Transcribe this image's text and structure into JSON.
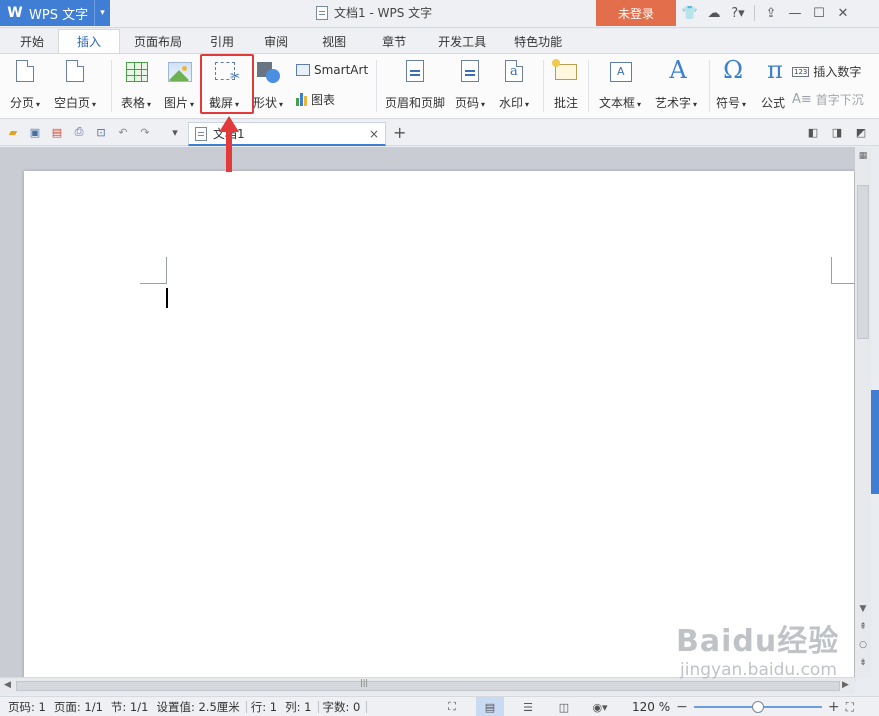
{
  "app": {
    "name": "WPS 文字",
    "window_title": "文档1 - WPS 文字",
    "login": "未登录"
  },
  "tabs": [
    "开始",
    "插入",
    "页面布局",
    "引用",
    "审阅",
    "视图",
    "章节",
    "开发工具",
    "特色功能"
  ],
  "active_tab": "插入",
  "ribbon": {
    "page_break": "分页",
    "blank_page": "空白页",
    "table": "表格",
    "picture": "图片",
    "screenshot": "截屏",
    "shape": "形状",
    "smartart": "SmartArt",
    "chart": "图表",
    "header_footer": "页眉和页脚",
    "page_number": "页码",
    "watermark": "水印",
    "comment": "批注",
    "text_box": "文本框",
    "word_art": "艺术字",
    "symbol": "符号",
    "formula": "公式",
    "insert_number": "插入数字",
    "drop_cap": "首字下沉",
    "symbol_glyph": "Ω",
    "formula_glyph": "π",
    "wordart_glyph": "A",
    "number_badge": "123"
  },
  "document_tab": {
    "name": "文档1",
    "close": "×",
    "new": "+"
  },
  "status": {
    "page_num": "页码: 1",
    "pages": "页面: 1/1",
    "section": "节: 1/1",
    "setting": "设置值: 2.5厘米",
    "row": "行: 1",
    "col": "列: 1",
    "words": "字数: 0",
    "zoom": "120 %",
    "zoom_level": 0.5
  },
  "watermark_text": {
    "brand": "Baidu经验",
    "site": "jingyan.baidu.com"
  },
  "colors": {
    "accent": "#3f7ed4",
    "login": "#e36e4b",
    "highlight": "#e23a3a"
  }
}
